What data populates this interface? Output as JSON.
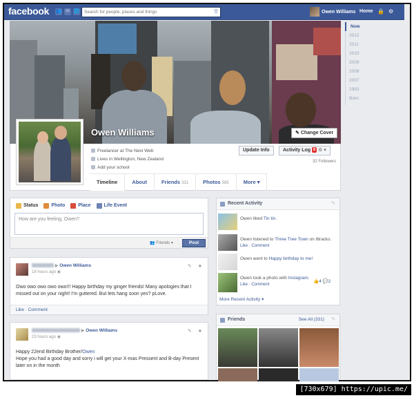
{
  "topbar": {
    "logo": "facebook",
    "search_placeholder": "Search for people, places and things",
    "user_name": "Owen Williams",
    "home_label": "Home",
    "bg_color": "#3b5998"
  },
  "rail": [
    "Now",
    "2012",
    "2011",
    "2010",
    "2009",
    "2008",
    "2007",
    "1993",
    "Born"
  ],
  "profile": {
    "name": "Owen Williams",
    "change_cover": "Change Cover",
    "info": [
      "Freelancer at The Next Web",
      "Lives in Wellington, New Zealand",
      "Add your school"
    ],
    "update_info": "Update Info",
    "activity_log": "Activity Log",
    "activity_badge": "8",
    "followers": "32 Followers",
    "tabs": [
      {
        "label": "Timeline",
        "count": ""
      },
      {
        "label": "About",
        "count": ""
      },
      {
        "label": "Friends",
        "count": "331"
      },
      {
        "label": "Photos",
        "count": "585"
      },
      {
        "label": "More",
        "count": ""
      }
    ]
  },
  "composer": {
    "tabs": [
      "Status",
      "Photo",
      "Place",
      "Life Event"
    ],
    "placeholder": "How are you feeling, Owen?",
    "audience": "Friends",
    "post_label": "Post"
  },
  "posts": [
    {
      "target": "Owen Williams",
      "time": "18 hours ago",
      "body": "Owo owo owo owo owo!!! Happy birthday my ginger friends! Many apologies that I missed out on your night! I'm guttered. But lets hang soon yes? pLove.",
      "like": "Like",
      "comment": "Comment"
    },
    {
      "target": "Owen Williams",
      "time": "23 hours ago",
      "body_prefix": "Happy 22end Birthday Brother/",
      "body_link": "Owen",
      "body_rest": "Hope you had a good day and sorry i will get your X-mas Pressent and B-day Present later on in the month"
    }
  ],
  "recent_activity": {
    "title": "Recent Activity",
    "items": [
      {
        "prefix": "Owen liked ",
        "link": "Tin tin",
        "suffix": ".",
        "sub": ""
      },
      {
        "prefix": "Owen listened to ",
        "link": "Three Tree Town",
        "suffix": " on 8tracks.",
        "sub": "Like · Comment"
      },
      {
        "prefix": "Owen went to ",
        "link": "Happy birthday to me!",
        "suffix": "",
        "sub": ""
      },
      {
        "prefix": "Owen took a photo with ",
        "link": "Instagram",
        "suffix": ".",
        "sub": "Like · Comment"
      }
    ],
    "likes": "4",
    "comments": "2",
    "more": "More Recent Activity"
  },
  "friends": {
    "title": "Friends",
    "see_all": "See All (331)"
  }
}
